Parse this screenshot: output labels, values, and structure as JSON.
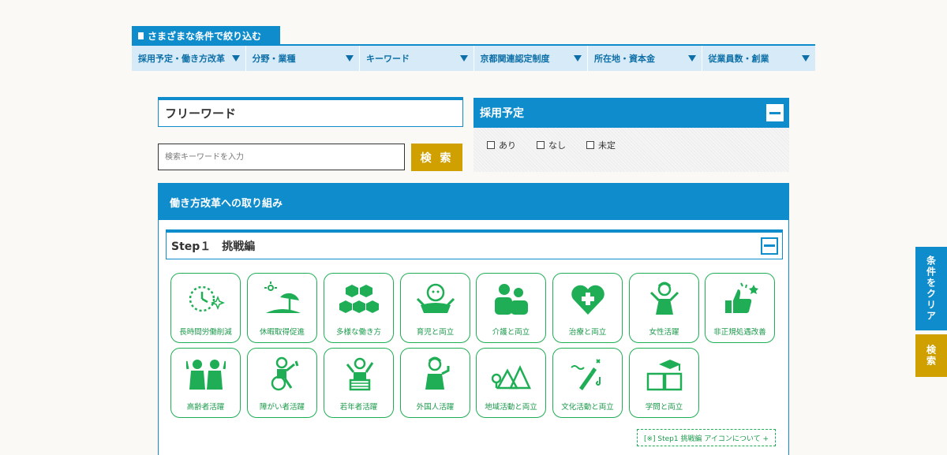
{
  "filter": {
    "tab_label": "さまざまな条件で絞り込む",
    "categories": [
      {
        "label": "採用予定・働き方改革"
      },
      {
        "label": "分野・業種"
      },
      {
        "label": "キーワード"
      },
      {
        "label": "京都関連認定制度"
      },
      {
        "label": "所在地・資本金"
      },
      {
        "label": "従業員数・創業"
      }
    ]
  },
  "freeword": {
    "title": "フリーワード",
    "placeholder": "検索キーワードを入力",
    "search_label": "検 索"
  },
  "recruit": {
    "title": "採用予定",
    "options": [
      {
        "label": "あり"
      },
      {
        "label": "なし"
      },
      {
        "label": "未定"
      }
    ]
  },
  "work_reform": {
    "title": "働き方改革への取り組み",
    "step_title": "Step１　挑戦編",
    "icons": [
      {
        "label": "長時間労働削減",
        "icon": "clock-icon"
      },
      {
        "label": "休暇取得促進",
        "icon": "beach-umbrella-icon"
      },
      {
        "label": "多様な働き方",
        "icon": "hexagons-icon"
      },
      {
        "label": "育児と両立",
        "icon": "child-icon"
      },
      {
        "label": "介護と両立",
        "icon": "caregiver-icon"
      },
      {
        "label": "治療と両立",
        "icon": "heart-cross-icon"
      },
      {
        "label": "女性活躍",
        "icon": "woman-icon"
      },
      {
        "label": "非正規処遇改善",
        "icon": "thumbs-up-icon"
      },
      {
        "label": "高齢者活躍",
        "icon": "seniors-icon"
      },
      {
        "label": "障がい者活躍",
        "icon": "wheelchair-icon"
      },
      {
        "label": "若年者活躍",
        "icon": "youth-icon"
      },
      {
        "label": "外国人活躍",
        "icon": "foreigner-icon"
      },
      {
        "label": "地域活動と両立",
        "icon": "mountains-icon"
      },
      {
        "label": "文化活動と両立",
        "icon": "brush-icon"
      },
      {
        "label": "学問と両立",
        "icon": "graduation-book-icon"
      }
    ],
    "about_link": "[※] Step1 挑戦編 アイコンについて +"
  },
  "side": {
    "clear_label": "条件をクリア",
    "search_label": "検索"
  },
  "colors": {
    "primary": "#0e8ccc",
    "accent": "#cfa000",
    "icon_green": "#1fae55"
  }
}
